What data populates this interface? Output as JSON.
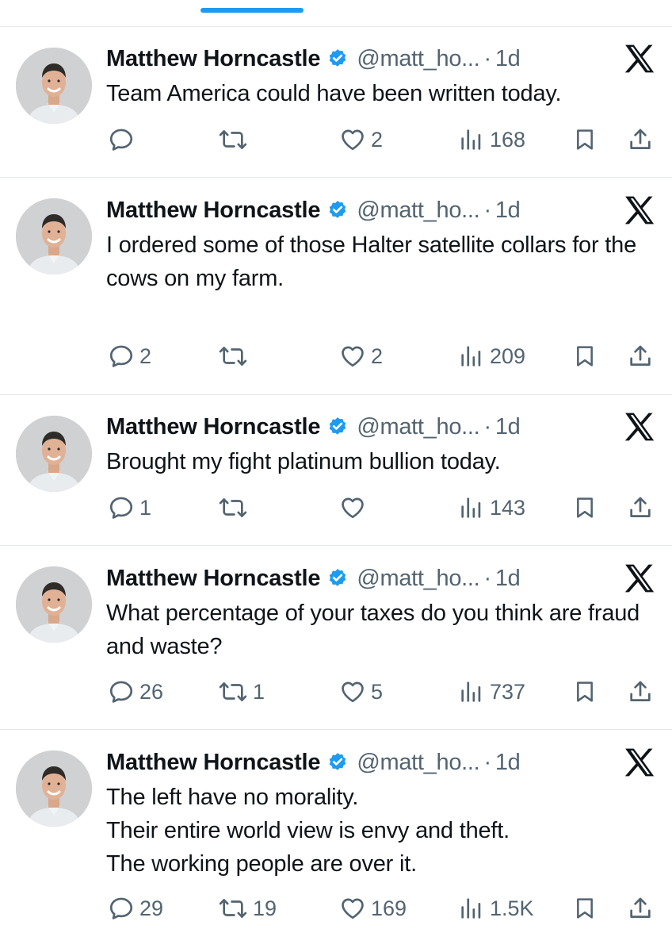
{
  "colors": {
    "accent": "#1d9bf0",
    "text": "#0f1419",
    "muted": "#536471",
    "divider": "#e6e9ec"
  },
  "icons": {
    "reply": "reply-icon",
    "retweet": "retweet-icon",
    "like": "heart-icon",
    "views": "views-icon",
    "bookmark": "bookmark-icon",
    "share": "share-icon",
    "verified": "verified-badge-icon",
    "platform": "x-logo-icon"
  },
  "tweets": [
    {
      "author": "Matthew Horncastle",
      "handle": "@matt_ho...",
      "dot": "·",
      "time": "1d",
      "text": "Team America could have been written today.",
      "replies": "",
      "retweets": "",
      "likes": "2",
      "views": "168"
    },
    {
      "author": "Matthew Horncastle",
      "handle": "@matt_ho...",
      "dot": "·",
      "time": "1d",
      "text": "I ordered some of those Halter satellite collars for the cows on my farm.",
      "replies": "2",
      "retweets": "",
      "likes": "2",
      "views": "209"
    },
    {
      "author": "Matthew Horncastle",
      "handle": "@matt_ho...",
      "dot": "·",
      "time": "1d",
      "text": "Brought my fight platinum bullion today.",
      "replies": "1",
      "retweets": "",
      "likes": "",
      "views": "143"
    },
    {
      "author": "Matthew Horncastle",
      "handle": "@matt_ho...",
      "dot": "·",
      "time": "1d",
      "text": "What percentage of your taxes do you think are fraud and waste?",
      "replies": "26",
      "retweets": "1",
      "likes": "5",
      "views": "737"
    },
    {
      "author": "Matthew Horncastle",
      "handle": "@matt_ho...",
      "dot": "·",
      "time": "1d",
      "text": "The left have no morality.\nTheir entire world view is envy and theft.\nThe working people are over it.",
      "replies": "29",
      "retweets": "19",
      "likes": "169",
      "views": "1.5K"
    }
  ]
}
